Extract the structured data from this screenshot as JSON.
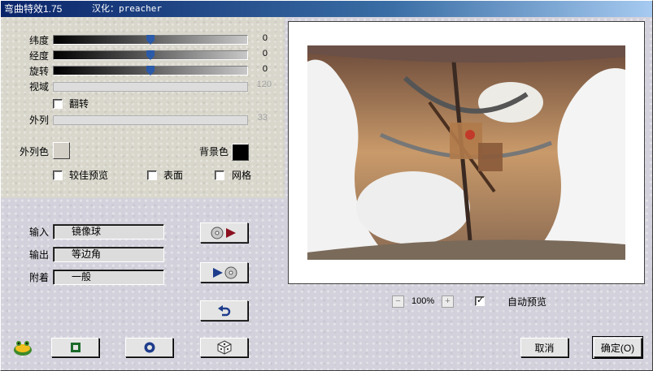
{
  "title": {
    "app": "弯曲特效1.75",
    "credit": "汉化：preacher"
  },
  "sliders": [
    {
      "label": "纬度",
      "value": "0",
      "level": 0.5,
      "enabled": true
    },
    {
      "label": "经度",
      "value": "0",
      "level": 0.5,
      "enabled": true
    },
    {
      "label": "旋转",
      "value": "0",
      "level": 0.5,
      "enabled": true
    },
    {
      "label": "视域",
      "value": "120",
      "level": 1.0,
      "enabled": false
    },
    {
      "label": "外列",
      "value": "33",
      "level": 1.0,
      "enabled": false
    }
  ],
  "flip": {
    "label": "翻转",
    "checked": false
  },
  "colors": {
    "outer_label": "外列色",
    "outer_color": "#d4d0c8",
    "background_label": "背景色",
    "background_color": "#000000"
  },
  "options": [
    {
      "label": "较佳预览",
      "checked": false
    },
    {
      "label": "表面",
      "checked": false
    },
    {
      "label": "网格",
      "checked": false
    }
  ],
  "mapping": {
    "input_label": "输入",
    "input_value": "镜像球",
    "output_label": "输出",
    "output_value": "等边角",
    "attach_label": "附着",
    "attach_value": "一般"
  },
  "icons": {
    "forward": "sphere-to-play-icon",
    "backward": "play-to-sphere-icon",
    "undo": "undo-arrow-icon",
    "logo": "frog-logo-icon",
    "square": "square-icon",
    "circle": "circle-icon",
    "dice": "dice-icon"
  },
  "zoom": {
    "level": "100%",
    "minus": "−",
    "plus": "+"
  },
  "auto_preview": {
    "label": "自动预览",
    "checked": true
  },
  "buttons": {
    "cancel": "取消",
    "ok": "确定(O)"
  }
}
